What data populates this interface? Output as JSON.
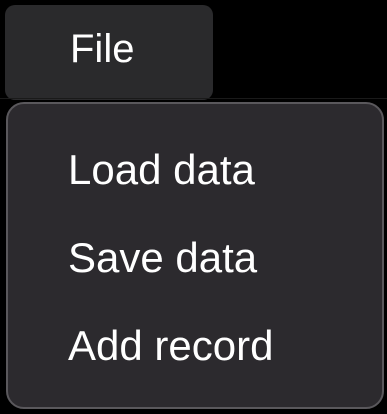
{
  "menubar": {
    "title": "File"
  },
  "dropdown": {
    "items": [
      {
        "label": "Load data"
      },
      {
        "label": "Save data"
      },
      {
        "label": "Add record"
      }
    ]
  },
  "colors": {
    "background": "#000000",
    "menu_bg": "#2c2a2e",
    "menu_border": "#5a585c",
    "title_bg": "#2a2a2c",
    "text": "#ffffff"
  }
}
